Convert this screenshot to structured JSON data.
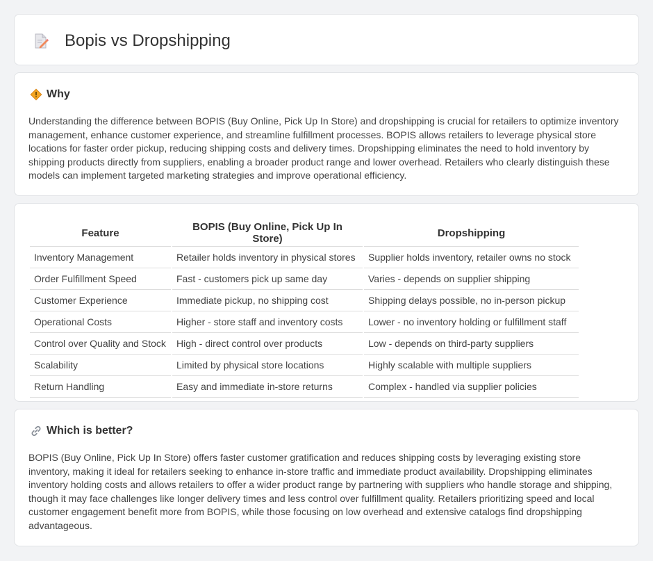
{
  "header": {
    "title": "Bopis vs Dropshipping",
    "icon": "document-pencil-icon"
  },
  "why": {
    "heading": "Why",
    "icon": "warning-sign-icon",
    "text": "Understanding the difference between BOPIS (Buy Online, Pick Up In Store) and dropshipping is crucial for retailers to optimize inventory management, enhance customer experience, and streamline fulfillment processes. BOPIS allows retailers to leverage physical store locations for faster order pickup, reducing shipping costs and delivery times. Dropshipping eliminates the need to hold inventory by shipping products directly from suppliers, enabling a broader product range and lower overhead. Retailers who clearly distinguish these models can implement targeted marketing strategies and improve operational efficiency."
  },
  "table": {
    "headers": [
      "Feature",
      "BOPIS (Buy Online, Pick Up In Store)",
      "Dropshipping"
    ],
    "rows": [
      [
        "Inventory Management",
        "Retailer holds inventory in physical stores",
        "Supplier holds inventory, retailer owns no stock"
      ],
      [
        "Order Fulfillment Speed",
        "Fast - customers pick up same day",
        "Varies - depends on supplier shipping"
      ],
      [
        "Customer Experience",
        "Immediate pickup, no shipping cost",
        "Shipping delays possible, no in-person pickup"
      ],
      [
        "Operational Costs",
        "Higher - store staff and inventory costs",
        "Lower - no inventory holding or fulfillment staff"
      ],
      [
        "Control over Quality and Stock",
        "High - direct control over products",
        "Low - depends on third-party suppliers"
      ],
      [
        "Scalability",
        "Limited by physical store locations",
        "Highly scalable with multiple suppliers"
      ],
      [
        "Return Handling",
        "Easy and immediate in-store returns",
        "Complex - handled via supplier policies"
      ]
    ]
  },
  "better": {
    "heading": "Which is better?",
    "icon": "link-icon",
    "text": "BOPIS (Buy Online, Pick Up In Store) offers faster customer gratification and reduces shipping costs by leveraging existing store inventory, making it ideal for retailers seeking to enhance in-store traffic and immediate product availability. Dropshipping eliminates inventory holding costs and allows retailers to offer a wider product range by partnering with suppliers who handle storage and shipping, though it may face challenges like longer delivery times and less control over fulfillment quality. Retailers prioritizing speed and local customer engagement benefit more from BOPIS, while those focusing on low overhead and extensive catalogs find dropshipping advantageous."
  }
}
